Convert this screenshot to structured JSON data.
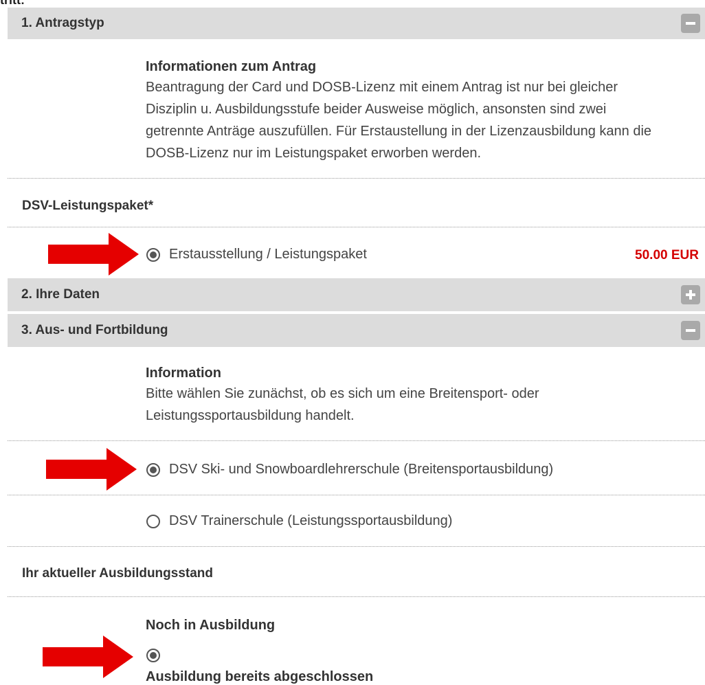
{
  "top_fragment": "tritt:",
  "sections": {
    "antragstyp": {
      "title": "1. Antragstyp",
      "icon": "minus-icon"
    },
    "ihre_daten": {
      "title": "2. Ihre Daten",
      "icon": "plus-icon"
    },
    "ausbildung": {
      "title": "3. Aus- und Fortbildung",
      "icon": "minus-icon"
    }
  },
  "antrag_info": {
    "title": "Informationen zum Antrag",
    "lines": [
      "Beantragung der Card und DOSB-Lizenz mit einem Antrag ist nur bei gleicher",
      "Disziplin u. Ausbildungsstufe beider Ausweise möglich, ansonsten sind zwei",
      "getrennte Anträge auszufüllen. Für Erstaustellung in der Lizenzausbildung kann die",
      "DOSB-Lizenz nur im Leistungspaket erworben werden."
    ]
  },
  "leistungspaket": {
    "label": "DSV-Leistungspaket*",
    "option_label": "Erstausstellung / Leistungspaket",
    "price": "50.00 EUR",
    "checked": true
  },
  "ausbildung_info": {
    "title": "Information",
    "lines": [
      "Bitte wählen Sie zunächst, ob es sich um eine Breitensport- oder",
      "Leistungssportausbildung handelt."
    ]
  },
  "schule_options": [
    {
      "label": "DSV Ski- und Snowboardlehrerschule (Breitensportausbildung)",
      "checked": true
    },
    {
      "label": "DSV Trainerschule (Leistungssportausbildung)",
      "checked": false
    }
  ],
  "ausbildungsstand": {
    "label": "Ihr aktueller Ausbildungsstand",
    "option1_label": "Noch in Ausbildung",
    "option1_checked": true,
    "option2_label": "Ausbildung bereits abgeschlossen"
  },
  "colors": {
    "header_bg": "#dcdcdc",
    "toggle_icon": "#a9a9a9",
    "price": "#d40000",
    "arrow": "#e50000"
  }
}
